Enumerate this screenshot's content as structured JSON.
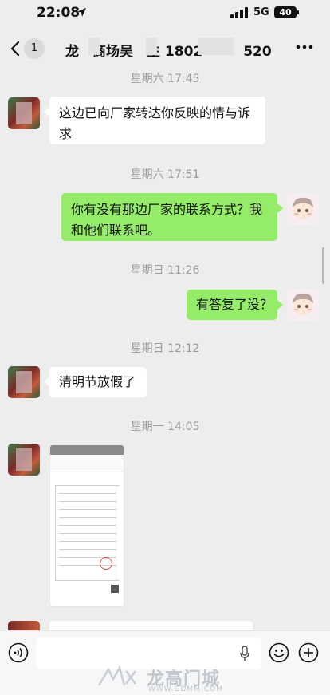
{
  "status_bar": {
    "time": "22:08",
    "network": "5G",
    "battery": "40"
  },
  "nav": {
    "unread_count": "1",
    "title": "龙　商场吴　生 1802　　　520"
  },
  "messages": [
    {
      "type": "timestamp",
      "text": "星期六 17:45"
    },
    {
      "type": "text",
      "side": "left",
      "text_line1": "这边已向厂家转达你反映的情与诉",
      "text_line2": "求"
    },
    {
      "type": "timestamp",
      "text": "星期六 17:51"
    },
    {
      "type": "text",
      "side": "right",
      "text_line1": "你有没有那边厂家的联系方式？我",
      "text_line2": "和他们联系吧。"
    },
    {
      "type": "timestamp",
      "text": "星期日 11:26"
    },
    {
      "type": "text",
      "side": "right",
      "text": "有答复了没？"
    },
    {
      "type": "timestamp",
      "text": "星期日 12:12"
    },
    {
      "type": "text",
      "side": "left",
      "text": "清明节放假了"
    },
    {
      "type": "timestamp",
      "text": "星期一 14:05"
    },
    {
      "type": "image",
      "side": "left"
    }
  ],
  "input_bar": {
    "value": "",
    "placeholder": ""
  },
  "watermark": {
    "text": "龙高门城",
    "url": "WWW.GDMM.COM"
  },
  "colors": {
    "chat_bg": "#ededed",
    "my_bubble": "#95ec69",
    "their_bubble": "#ffffff",
    "timestamp": "#9a9a9a"
  }
}
